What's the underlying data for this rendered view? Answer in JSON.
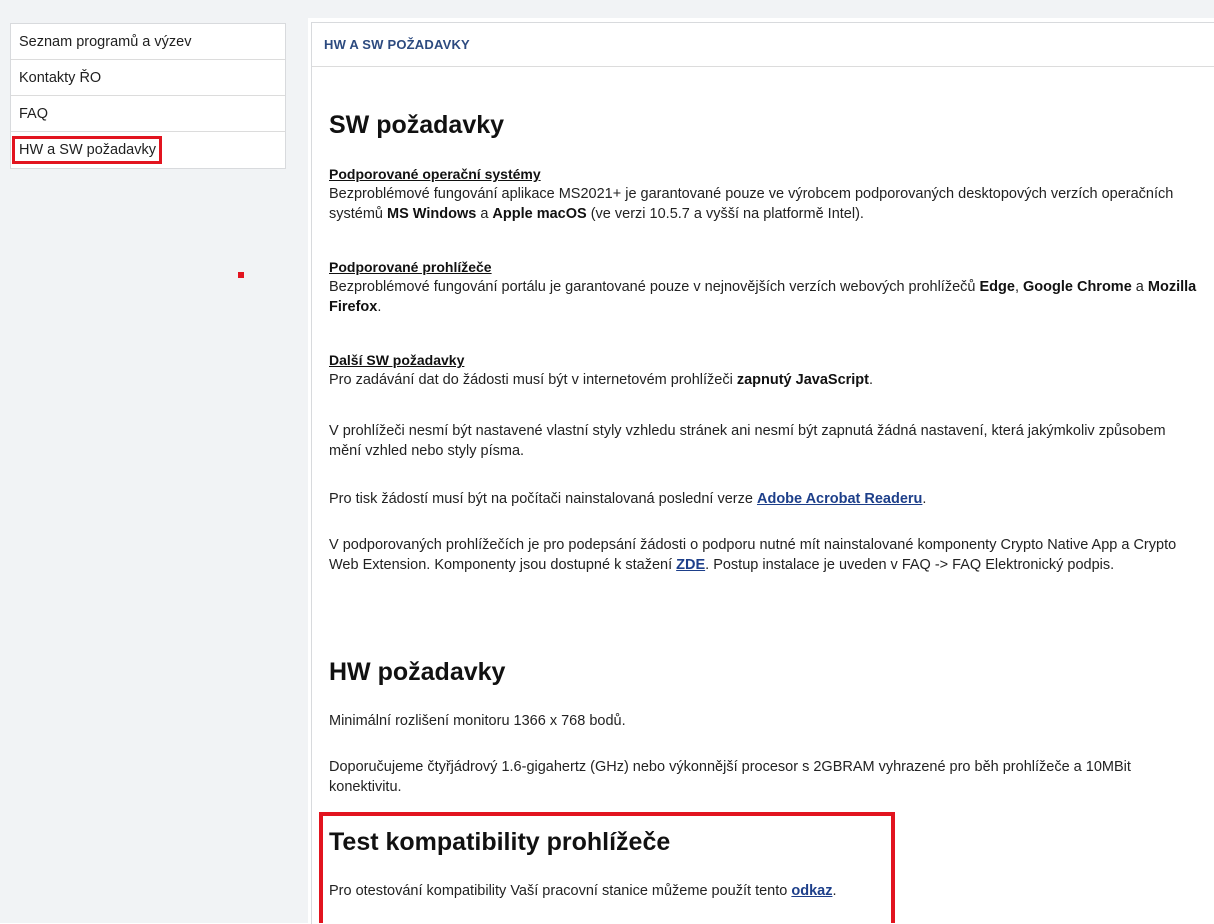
{
  "sidebar": {
    "items": [
      {
        "label": "Seznam programů a výzev"
      },
      {
        "label": "Kontakty ŘO"
      },
      {
        "label": "FAQ"
      },
      {
        "label": "HW a SW požadavky",
        "active": true
      }
    ]
  },
  "panel": {
    "header": "HW A SW POŽADAVKY"
  },
  "sw": {
    "heading": "SW požadavky",
    "os": {
      "title": "Podporované operační systémy",
      "t1": "Bezproblémové fungování aplikace MS2021+ je garantované pouze ve výrobcem podporovaných desktopových verzích operačních systémů ",
      "b1": "MS Windows",
      "t2": " a ",
      "b2": "Apple macOS",
      "t3": " (ve verzi 10.5.7 a vyšší na platformě Intel)."
    },
    "browsers": {
      "title": "Podporované prohlížeče",
      "t1": "Bezproblémové fungování portálu je garantované pouze v nejnovějších verzích webových prohlížečů ",
      "b1": "Edge",
      "t2": ", ",
      "b2": "Google Chrome",
      "t3": " a ",
      "b3": "Mozilla Firefox",
      "t4": "."
    },
    "other": {
      "title": "Další SW požadavky",
      "t1": "Pro zadávání dat do žádosti musí být v internetovém prohlížeči ",
      "b1": "zapnutý JavaScript",
      "t2": "."
    },
    "styles_text": "V prohlížeči nesmí být nastavené vlastní styly vzhledu stránek ani nesmí být zapnutá žádná nastavení, která jakýmkoliv způsobem mění vzhled nebo styly písma.",
    "print": {
      "t1": "Pro tisk žádostí musí být na počítači nainstalovaná poslední verze ",
      "link": "Adobe Acrobat Readeru",
      "t2": "."
    },
    "crypto": {
      "t1": "V podporovaných prohlížečích je pro podepsání žádosti o podporu nutné mít nainstalované komponenty Crypto Native App a Crypto Web Extension. Komponenty jsou dostupné k stažení ",
      "link": "ZDE",
      "t2": ". Postup instalace je uveden v FAQ -> FAQ Elektronický podpis."
    }
  },
  "hw": {
    "heading": "HW požadavky",
    "resolution": "Minimální rozlišení monitoru 1366 x 768 bodů.",
    "cpu": "Doporučujeme čtyřjádrový 1.6-gigahertz (GHz) nebo výkonnější procesor s 2GBRAM vyhrazené pro běh prohlížeče a 10MBit konektivitu."
  },
  "test": {
    "heading": "Test kompatibility prohlížeče",
    "t1": "Pro otestování kompatibility Vaší pracovní stanice můžeme použít tento ",
    "link": "odkaz",
    "t2": "."
  },
  "colors": {
    "highlight": "#e2141f",
    "link": "#1d3f8a",
    "header_text": "#2c4a7f"
  }
}
